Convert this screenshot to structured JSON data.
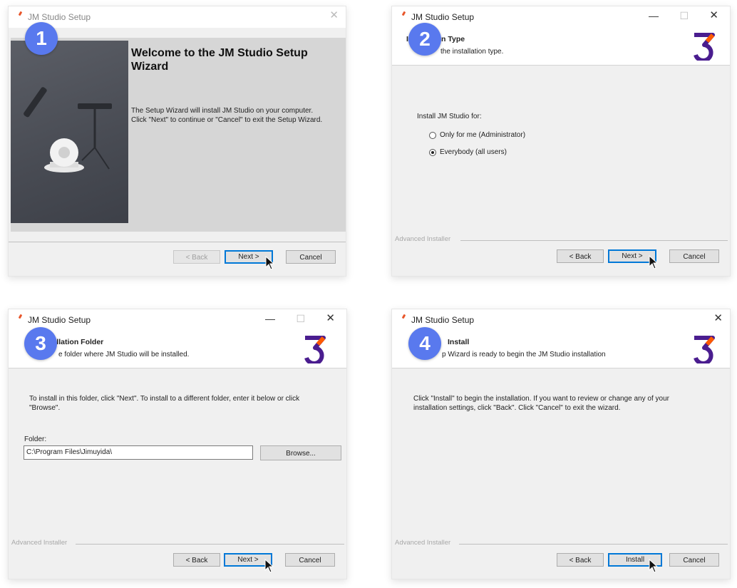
{
  "colors": {
    "accent": "#5979ee",
    "brand_purple": "#4a1d8f",
    "brand_orange": "#ff5a00",
    "focus": "#0078d7"
  },
  "w1": {
    "badge": "1",
    "title": "JM Studio Setup",
    "heading": "Welcome to the JM Studio Setup Wizard",
    "body_line1": "The Setup Wizard will install JM Studio on your computer.",
    "body_line2": "Click \"Next\" to continue or \"Cancel\" to exit the Setup Wizard.",
    "back": "< Back",
    "next": "Next >",
    "cancel": "Cancel"
  },
  "w2": {
    "badge": "2",
    "title": "JM Studio Setup",
    "header_title": "Installation Type",
    "header_sub": "the installation type.",
    "prompt": "Install JM Studio for:",
    "options": [
      "Only for me (Administrator)",
      "Everybody (all users)"
    ],
    "selected_option": "Everybody (all users)",
    "footer": "Advanced Installer",
    "back": "< Back",
    "next": "Next >",
    "cancel": "Cancel"
  },
  "w3": {
    "badge": "3",
    "title": "JM Studio Setup",
    "header_title": "tallation Folder",
    "header_sub": "e folder where JM Studio will be installed.",
    "instructions_line1": "To install in this folder, click \"Next\". To install to a different folder, enter it below or click",
    "instructions_line2": "\"Browse\".",
    "folder_label": "Folder:",
    "folder_value": "C:\\Program Files\\Jimuyida\\",
    "browse": "Browse...",
    "footer": "Advanced Installer",
    "back": "< Back",
    "next": "Next >",
    "cancel": "Cancel"
  },
  "w4": {
    "badge": "4",
    "title": "JM Studio Setup",
    "header_title": "Install",
    "header_sub": "p Wizard is ready to begin the JM Studio installation",
    "body_line1": "Click \"Install\" to begin the installation.  If you want to review or change any of your",
    "body_line2": "installation settings, click \"Back\".  Click \"Cancel\" to exit the wizard.",
    "footer": "Advanced Installer",
    "back": "< Back",
    "install": "Install",
    "cancel": "Cancel"
  },
  "window_controls": {
    "minimize": "—",
    "maximize": "☐",
    "close": "✕"
  }
}
